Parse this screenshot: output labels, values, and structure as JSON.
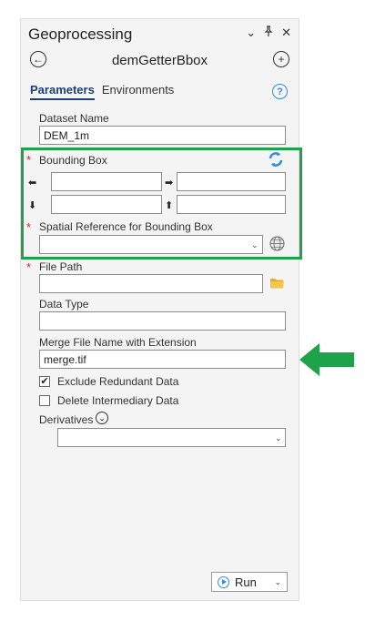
{
  "pane": {
    "title": "Geoprocessing",
    "controls": {
      "menu": "⌄",
      "pin": "📌",
      "close": "✕"
    },
    "tool_name": "demGetterBbox",
    "tabs": [
      {
        "label": "Parameters"
      },
      {
        "label": "Environments"
      }
    ]
  },
  "params": {
    "dataset_name": {
      "label": "Dataset Name",
      "value": "DEM_1m"
    },
    "bounding_box": {
      "label": "Bounding Box",
      "left": "",
      "right": "",
      "bottom": "",
      "top": ""
    },
    "spatial_ref": {
      "label": "Spatial Reference for Bounding Box",
      "value": ""
    },
    "file_path": {
      "label": "File Path",
      "value": ""
    },
    "data_type": {
      "label": "Data Type",
      "value": ""
    },
    "merge_file": {
      "label": "Merge File Name with Extension",
      "value": "merge.tif"
    },
    "exclude_redundant": {
      "label": "Exclude Redundant Data",
      "checked": true
    },
    "delete_intermediary": {
      "label": "Delete Intermediary Data",
      "checked": false
    },
    "derivatives": {
      "label": "Derivatives",
      "value": ""
    }
  },
  "run": {
    "label": "Run"
  },
  "colors": {
    "highlight": "#1ea24a",
    "accent": "#2e8de0",
    "required": "#c62828"
  }
}
